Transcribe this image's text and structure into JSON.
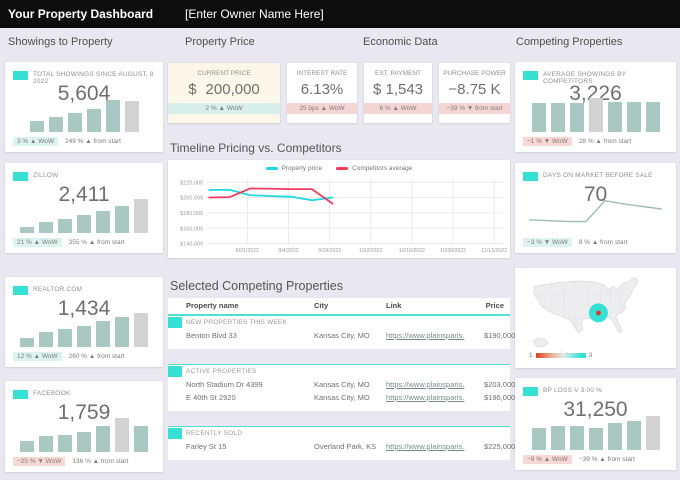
{
  "topbar": {
    "title": "Your Property Dashboard",
    "owner": "[Enter Owner Name Here]"
  },
  "sections": {
    "showings": "Showings to Property",
    "price": "Property Price",
    "economic": "Economic Data",
    "competing": "Competing Properties"
  },
  "colors": {
    "accent_teal": "#36E0D4",
    "bar_teal": "#A9C8C4",
    "bar_gray": "#D2D2D3",
    "badge_teal": "#DCF3EE",
    "badge_pink": "#F8D7D5",
    "strip_teal": "#D8EFEA",
    "strip_pink": "#F5D5D3",
    "cream": "#FCF7E9",
    "line_property": "#1FD7DE",
    "line_competitors": "#F23A5E",
    "spark_line": "#9FBDB9",
    "map_marker_ring": "#36E0D4",
    "map_marker_dot": "#E0391F"
  },
  "cards": {
    "showings": [
      {
        "title": "TOTAL SHOWINGS SINCE AUGUST, 8 2022",
        "value": "5,604",
        "wow": "3 % ▲ WoW",
        "wow_badge": "teal",
        "start": "249 % ▲ from start",
        "bars": {
          "values": [
            30,
            43,
            52,
            63,
            88,
            85
          ],
          "highlight_index": 5
        }
      },
      {
        "title": "ZILLOW",
        "value": "2,411",
        "wow": "21 % ▲ WoW",
        "wow_badge": "teal",
        "start": "355 % ▲ from start",
        "bars": {
          "values": [
            18,
            30,
            38,
            50,
            62,
            75,
            95
          ],
          "highlight_index": 6
        }
      },
      {
        "title": "REALTOR.COM",
        "value": "1,434",
        "wow": "12 % ▲ WoW",
        "wow_badge": "teal",
        "start": "260 % ▲ from start",
        "bars": {
          "values": [
            25,
            42,
            50,
            58,
            72,
            82,
            95
          ],
          "highlight_index": 6
        }
      },
      {
        "title": "FACEBOOK",
        "value": "1,759",
        "wow": "−25 % ▼ WoW",
        "wow_badge": "pink",
        "start": "136 % ▲ from start",
        "bars": {
          "values": [
            30,
            45,
            48,
            55,
            72,
            95,
            72
          ],
          "highlight_index": 5
        }
      }
    ],
    "economic": [
      {
        "title": "CURRENT PRICE",
        "currency": "$",
        "amount": "200,000",
        "delta": "2 % ▲ WoW",
        "strip": "teal",
        "bg": "cream"
      },
      {
        "title": "INTEREST RATE",
        "value": "6.13%",
        "delta": "25 bps ▲ WoW",
        "strip": "pink",
        "bg": "white"
      },
      {
        "title": "EST. PAYMENT",
        "value": "$ 1,543",
        "delta": "6 % ▲ WoW",
        "strip": "pink",
        "bg": "white"
      },
      {
        "title": "PURCHASE POWER",
        "value": "−8.75 K",
        "delta": "−39 % ▼ from start",
        "strip": "pink",
        "bg": "white"
      }
    ],
    "competitors_avg": {
      "title": "AVERAGE SHOWINGS BY COMPETITORS",
      "value": "3,226",
      "wow": "−1 % ▼ WoW",
      "wow_badge": "pink",
      "start": "28 % ▲ from start",
      "bars": {
        "values": [
          80,
          80,
          80,
          95,
          84,
          82,
          82
        ],
        "highlight_index": 3
      }
    },
    "days_on_market": {
      "title": "DAYS ON MARKET BEFORE SALE",
      "value": "70",
      "wow": "−3 % ▼ WoW",
      "wow_badge": "teal",
      "start": "8 % ▲ from start",
      "spark": {
        "values": [
          11,
          10,
          9,
          9,
          34,
          30,
          27,
          24
        ]
      }
    },
    "bp_loss": {
      "title": "BP LOSS V 3.00 %",
      "value": "31,250",
      "wow": "−9 % ▲ WoW",
      "wow_badge": "pink",
      "start": "−39 % ▲ from start",
      "bars": {
        "values": [
          62,
          66,
          68,
          62,
          76,
          80,
          95
        ],
        "highlight_index": 6
      }
    }
  },
  "timeline": {
    "title": "Timeline Pricing vs. Competitors",
    "legend": [
      "Property price",
      "Competitors average"
    ],
    "y_ticks": [
      "$220,000",
      "$200,000",
      "$180,000",
      "$160,000",
      "$140,000"
    ],
    "y_values": [
      220000,
      200000,
      180000,
      160000,
      140000
    ],
    "x_ticks": [
      "8/21/2022",
      "9/4/2022",
      "9/18/2022",
      "10/2/2022",
      "10/16/2022",
      "10/30/2022",
      "11/13/2022"
    ],
    "axis_start": "8/7/2022",
    "axis_end": "11/16/2022",
    "ylim": [
      140000,
      224000
    ],
    "series": [
      {
        "name": "Property price",
        "color": "#1FD7DE",
        "dates": [
          "8/8/2022",
          "8/15/2022",
          "8/22/2022",
          "8/29/2022",
          "9/5/2022",
          "9/12/2022",
          "9/19/2022"
        ],
        "values": [
          210000,
          210000,
          203000,
          202000,
          201000,
          196500,
          200000
        ]
      },
      {
        "name": "Competitors average",
        "color": "#F23A5E",
        "dates": [
          "8/8/2022",
          "8/15/2022",
          "8/22/2022",
          "8/29/2022",
          "9/5/2022",
          "9/12/2022",
          "9/19/2022"
        ],
        "values": [
          200000,
          200500,
          212000,
          211500,
          211000,
          211000,
          192000
        ]
      }
    ]
  },
  "chart_data": {
    "type": "line",
    "title": "Timeline Pricing vs. Competitors",
    "x": [
      "8/8/2022",
      "8/15/2022",
      "8/22/2022",
      "8/29/2022",
      "9/5/2022",
      "9/12/2022",
      "9/19/2022"
    ],
    "series": [
      {
        "name": "Property price",
        "values": [
          210000,
          210000,
          203000,
          202000,
          201000,
          196500,
          200000
        ]
      },
      {
        "name": "Competitors average",
        "values": [
          200000,
          200500,
          212000,
          211500,
          211000,
          211000,
          192000
        ]
      }
    ],
    "ylim": [
      140000,
      224000
    ],
    "legend_position": "top"
  },
  "table": {
    "title": "Selected Competing Properties",
    "columns": [
      "Property name",
      "City",
      "Link",
      "Price"
    ],
    "groups": [
      {
        "label": "NEW PROPERTIES THIS WEEK",
        "rows": [
          {
            "name": "Benton Blvd 33",
            "city": "Kansas City, MO",
            "link": "https://www.plainsparis.",
            "price": "$190,000"
          }
        ]
      },
      {
        "label": "ACTIVE PROPERTIES",
        "rows": [
          {
            "name": "North Stadium Dr 4399",
            "city": "Kansas City, MO",
            "link": "https://www.plainsparis.",
            "price": "$203,000"
          },
          {
            "name": "E 40th St 2920",
            "city": "Kansas City, MO",
            "link": "https://www.plainsparis.",
            "price": "$196,000"
          }
        ]
      },
      {
        "label": "RECENTLY SOLD",
        "rows": [
          {
            "name": "Farley St 15",
            "city": "Overland Park, KS",
            "link": "https://www.plainsparis.",
            "price": "$225,000"
          }
        ]
      }
    ]
  },
  "map": {
    "legend_min": "1",
    "legend_max": "3"
  }
}
